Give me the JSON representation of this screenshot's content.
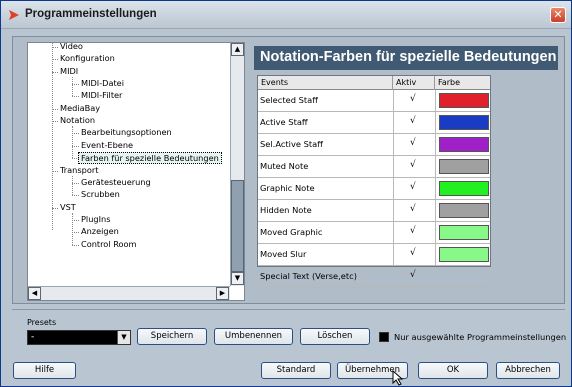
{
  "window": {
    "title": "Programmeinstellungen"
  },
  "tree": {
    "items": [
      {
        "label": "Video",
        "level": 1
      },
      {
        "label": "Konfiguration",
        "level": 1
      },
      {
        "label": "MIDI",
        "level": 1
      },
      {
        "label": "MIDI-Datei",
        "level": 2
      },
      {
        "label": "MIDI-Filter",
        "level": 2
      },
      {
        "label": "MediaBay",
        "level": 1
      },
      {
        "label": "Notation",
        "level": 1
      },
      {
        "label": "Bearbeitungsoptionen",
        "level": 2
      },
      {
        "label": "Event-Ebene",
        "level": 2
      },
      {
        "label": "Farben für spezielle Bedeutungen",
        "level": 2,
        "selected": true
      },
      {
        "label": "Transport",
        "level": 1
      },
      {
        "label": "Gerätesteuerung",
        "level": 2
      },
      {
        "label": "Scrubben",
        "level": 2
      },
      {
        "label": "VST",
        "level": 1
      },
      {
        "label": "PlugIns",
        "level": 2
      },
      {
        "label": "Anzeigen",
        "level": 2
      },
      {
        "label": "Control Room",
        "level": 2
      }
    ]
  },
  "panel": {
    "title": "Notation-Farben für spezielle Bedeutungen"
  },
  "grid": {
    "headers": {
      "events": "Events",
      "active": "Aktiv",
      "color": "Farbe"
    },
    "rows": [
      {
        "name": "Selected Staff",
        "active": "√",
        "color": "#e0202a"
      },
      {
        "name": "Active Staff",
        "active": "√",
        "color": "#1a3cc4"
      },
      {
        "name": "Sel.Active Staff",
        "active": "√",
        "color": "#a020c8"
      },
      {
        "name": "Muted Note",
        "active": "√",
        "color": "#a0a0a0"
      },
      {
        "name": "Graphic Note",
        "active": "√",
        "color": "#22f020"
      },
      {
        "name": "Hidden Note",
        "active": "√",
        "color": "#a0a0a0"
      },
      {
        "name": "Moved Graphic",
        "active": "√",
        "color": "#88f888"
      },
      {
        "name": "Moved Slur",
        "active": "√",
        "color": "#88f888"
      },
      {
        "name": "Special Text (Verse,etc)",
        "active": "√",
        "color": null
      }
    ]
  },
  "presets": {
    "label": "Presets",
    "value": "-",
    "save": "Speichern",
    "rename": "Umbenennen",
    "delete": "Löschen",
    "only_selected": "Nur ausgewählte Programmeinstellungen"
  },
  "footer": {
    "help": "Hilfe",
    "standard": "Standard",
    "apply": "Übernehmen",
    "ok": "OK",
    "cancel": "Abbrechen"
  }
}
